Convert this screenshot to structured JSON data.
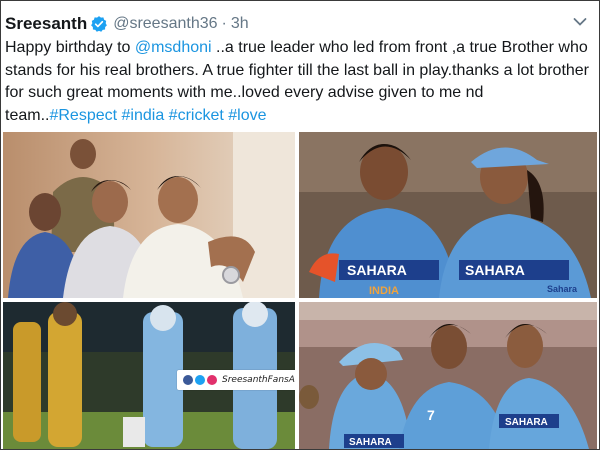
{
  "tweet": {
    "display_name": "Sreesanth",
    "handle": "@sreesanth36",
    "separator": "·",
    "time": "3h",
    "verified_color": "#1da1f2",
    "text_parts": {
      "t1": "Happy birthday to ",
      "mention": "@msdhoni",
      "t2": " ..a true leader who led from front ,a true Brother who stands for his real brothers. A true fighter till the last ball in play.thanks a lot brother for such great moments with me..loved every advise given to me nd team..",
      "hashtag1": "#Respect",
      "hashtag2": "#india",
      "hashtag3": "#cricket",
      "hashtag4": "#love"
    },
    "link_color": "#1b95e0"
  },
  "media": {
    "photo2": {
      "jersey_left": "SAHARA",
      "jersey_right": "SAHARA",
      "india": "INDIA",
      "brand": "Sahara"
    },
    "photo3": {
      "badge_text": "SreesanthFansAssociation"
    },
    "photo4": {
      "jersey_a": "SAHARA",
      "jersey_b": "SAHARA",
      "number": "7"
    }
  },
  "icons": [
    "verified-badge-icon",
    "chevron-down-icon",
    "facebook-icon",
    "twitter-icon",
    "instagram-icon"
  ]
}
